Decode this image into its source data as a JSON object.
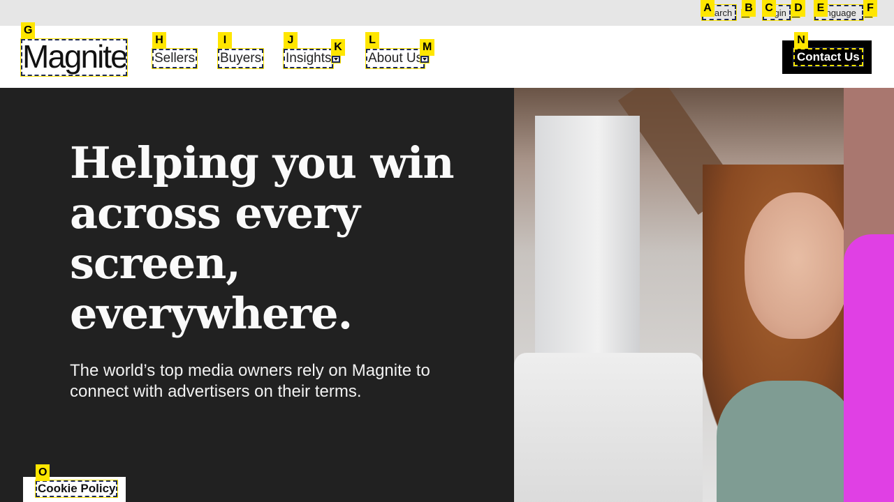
{
  "utility": {
    "search_label": "Search",
    "login_label": "Login",
    "language_label": "Language"
  },
  "header": {
    "logo_text": "Magnite",
    "nav": {
      "sellers": "Sellers",
      "buyers": "Buyers",
      "insights": "Insights",
      "about": "About Us"
    },
    "contact_label": "Contact Us"
  },
  "hero": {
    "headline_lines": [
      "Helping you win",
      "across every",
      "screen,",
      "everywhere."
    ],
    "subhead": "The world’s top media owners rely on Magnite to connect with advertisers on their terms."
  },
  "cookie": {
    "label": "Cookie Policy"
  },
  "markers": {
    "a": "A",
    "b": "B",
    "c": "C",
    "d": "D",
    "e": "E",
    "f": "F",
    "g": "G",
    "h": "H",
    "i": "I",
    "j": "J",
    "k": "K",
    "l": "L",
    "m": "M",
    "n": "N",
    "o": "O"
  },
  "colors": {
    "hero_bg": "#212121",
    "accent_pink": "#e040e4",
    "marker_yellow": "#ffe600",
    "contact_bg": "#000000"
  }
}
